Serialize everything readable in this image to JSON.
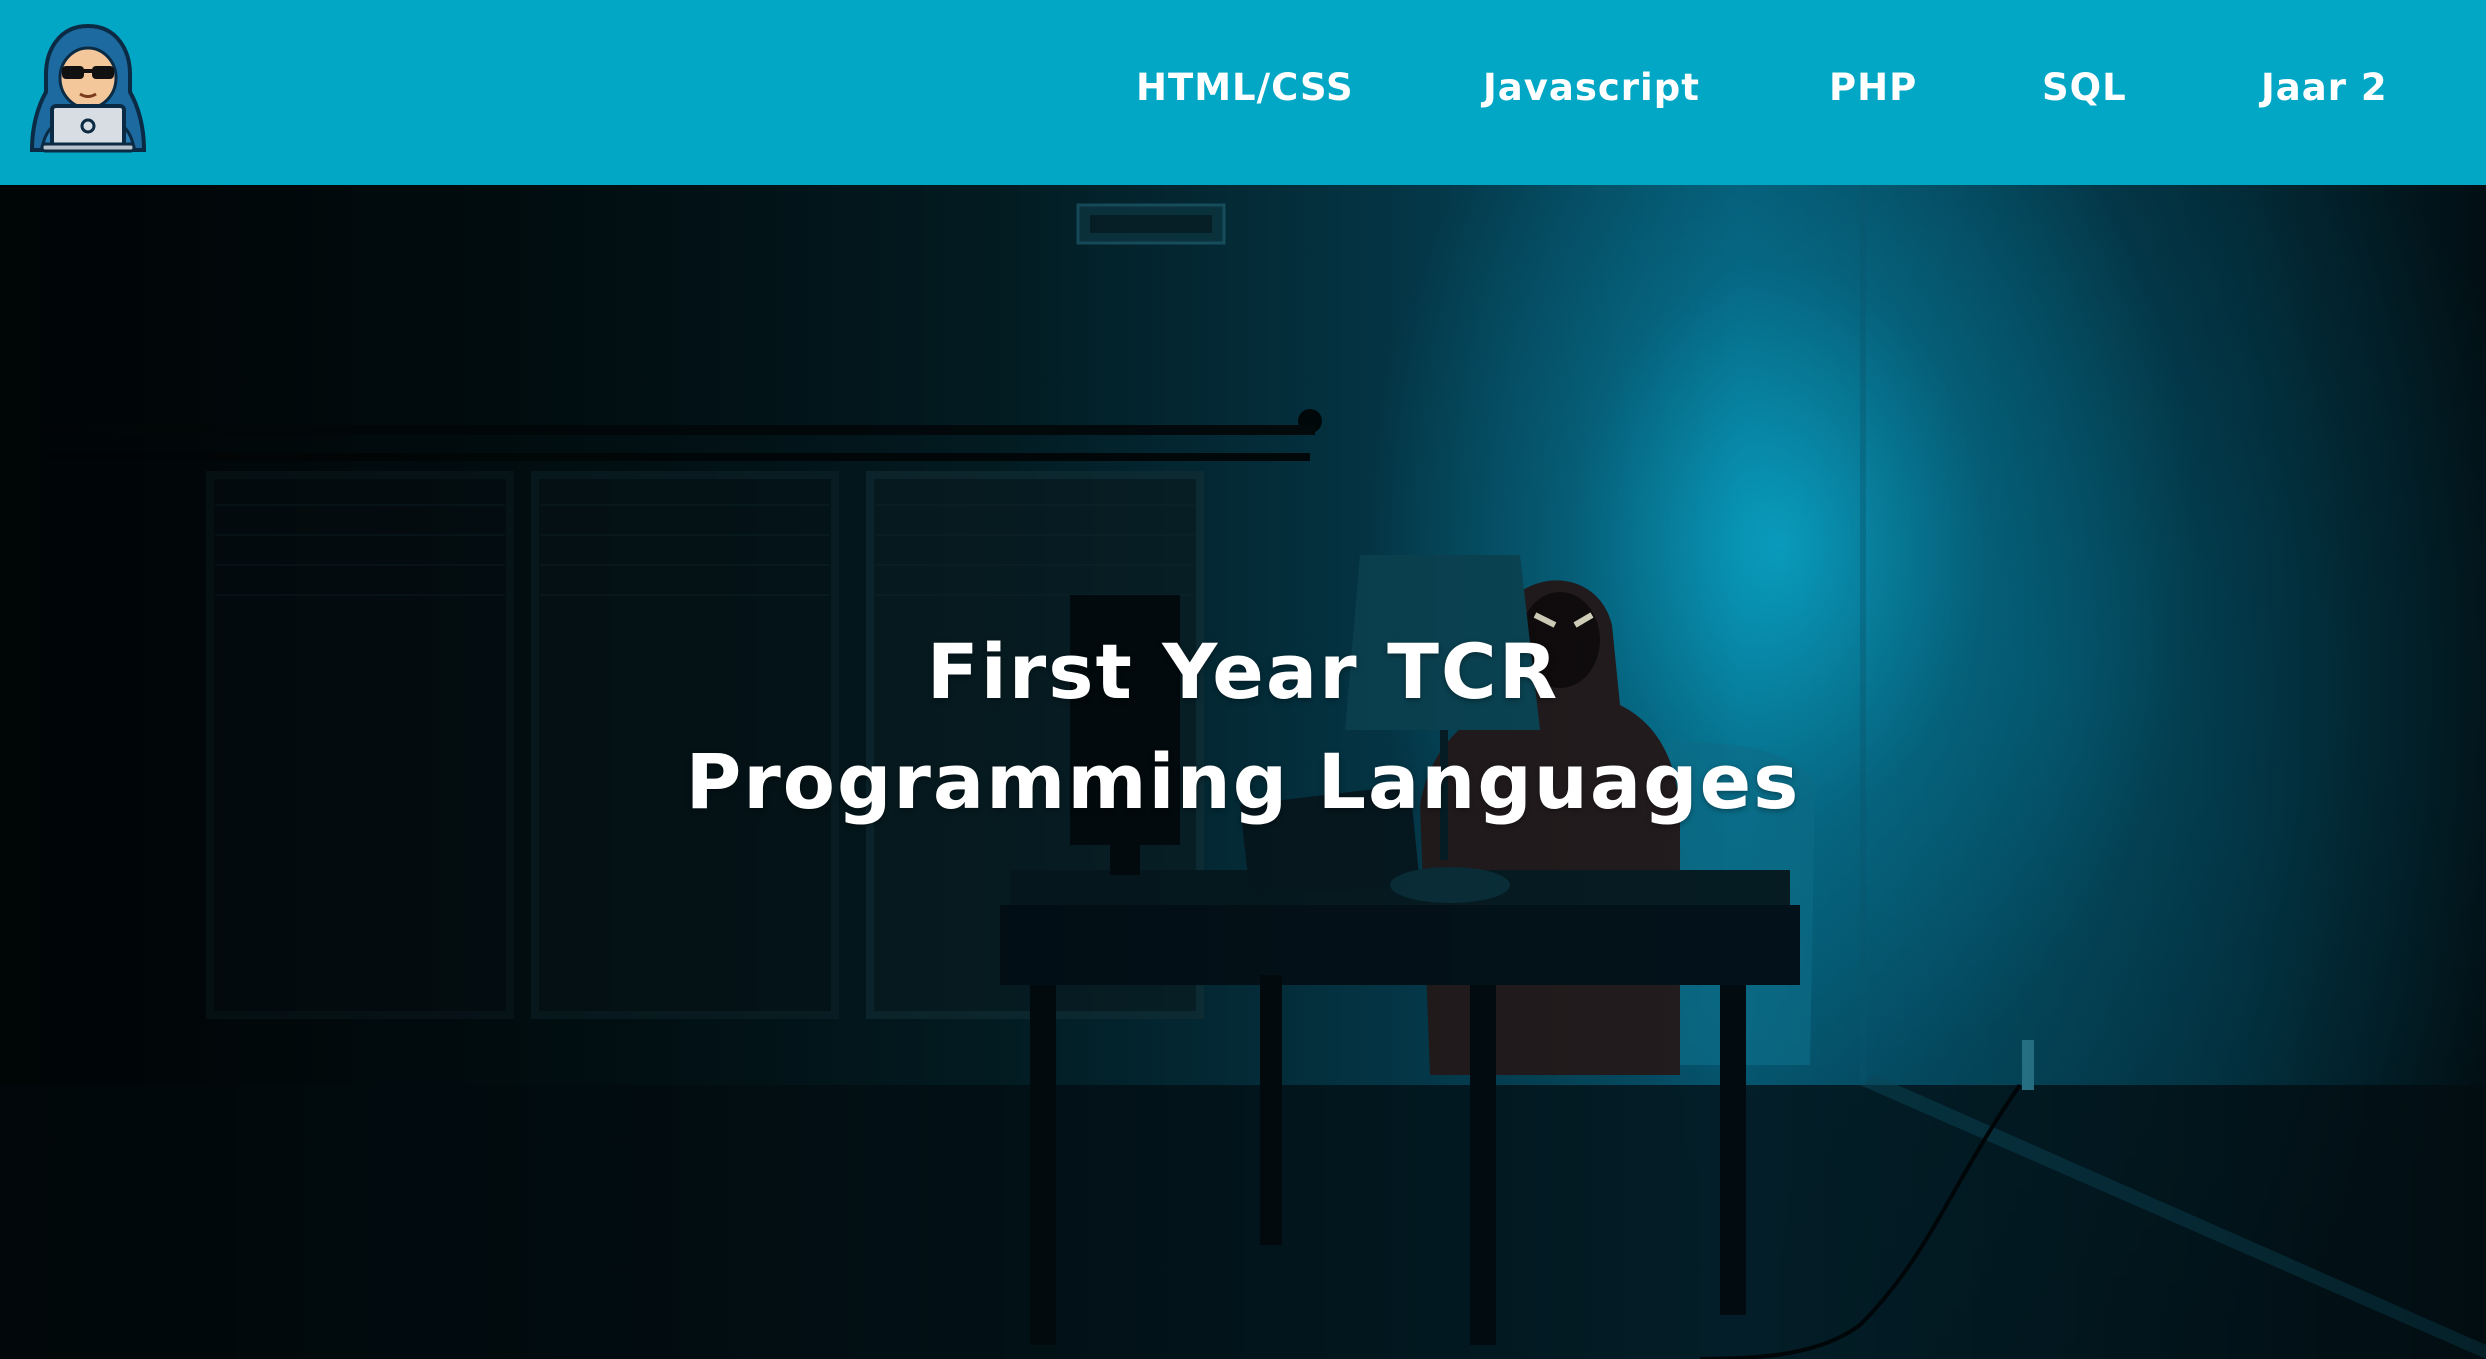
{
  "navbar": {
    "logo_icon": "hacker-with-laptop-icon",
    "background": "#02a7c6",
    "links": [
      {
        "label": "HTML/CSS"
      },
      {
        "label": "Javascript"
      },
      {
        "label": "PHP"
      },
      {
        "label": "SQL"
      },
      {
        "label": "Jaar 2"
      }
    ]
  },
  "hero": {
    "image": "dark-room-hooded-person-at-desk",
    "title_line_1": "First Year TCR",
    "title_line_2": "Programming Languages"
  }
}
